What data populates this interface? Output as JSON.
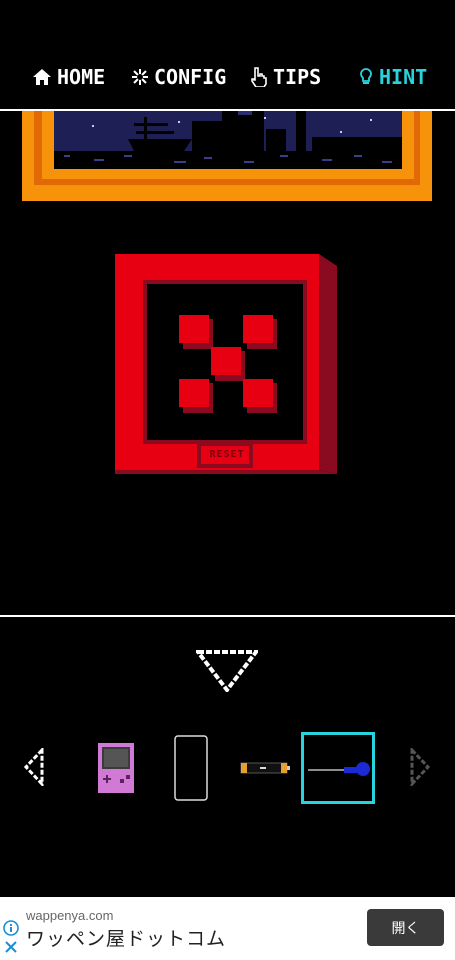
{
  "nav": {
    "home": "HOME",
    "config": "CONFIG",
    "tips": "TIPS",
    "hint": "HINT"
  },
  "puzzle": {
    "reset_label": "RESET",
    "tiles_raised": 5
  },
  "inventory": {
    "items": [
      "handheld-console",
      "smartphone",
      "battery",
      "screwdriver"
    ],
    "selected_index": 3
  },
  "colors": {
    "accent": "#27d3dc",
    "puzzle_red": "#e60012",
    "frame_orange": "#f7930a"
  },
  "ad": {
    "domain": "wappenya.com",
    "title": "ワッペン屋ドットコム",
    "button": "開く"
  }
}
